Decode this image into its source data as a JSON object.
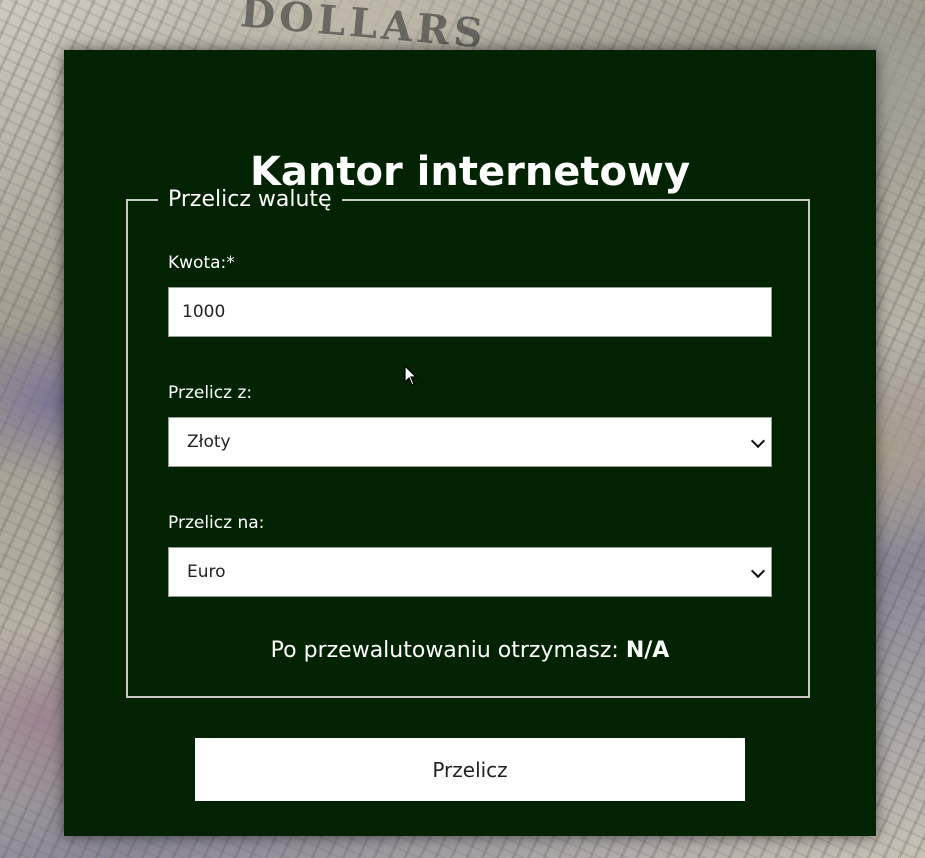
{
  "header": {
    "title": "Kantor internetowy"
  },
  "converter": {
    "legend": "Przelicz walutę",
    "amount": {
      "label": "Kwota:*",
      "value": "1000"
    },
    "from": {
      "label": "Przelicz z:",
      "selected": "Złoty"
    },
    "to": {
      "label": "Przelicz na:",
      "selected": "Euro"
    },
    "result": {
      "prefix": "Po przewalutowaniu otrzymasz:",
      "value": "N/A"
    }
  },
  "submit": {
    "label": "Przelicz"
  },
  "background": {
    "decor_text": "DOLLARS"
  },
  "colors": {
    "panel": "#012301",
    "text": "#ffffff",
    "field_bg": "#ffffff",
    "border": "#c8c8c4"
  },
  "icons": {
    "select_arrow": "chevron-down-icon",
    "pointer": "mouse-cursor-icon"
  }
}
